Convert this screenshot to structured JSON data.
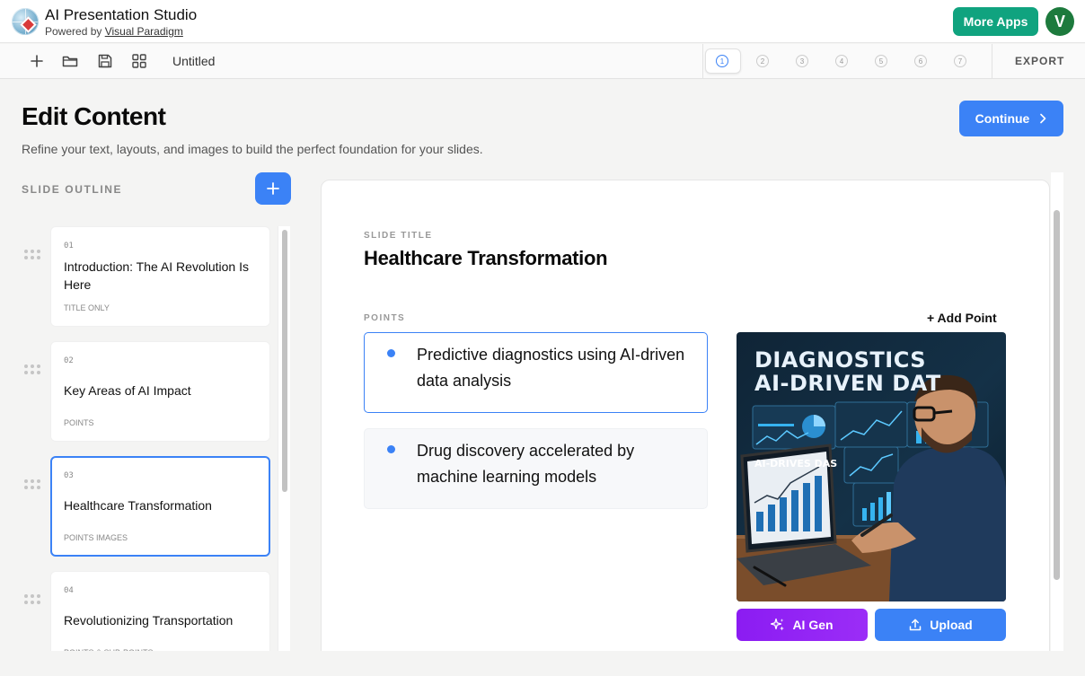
{
  "app": {
    "title": "AI Presentation Studio",
    "powered_prefix": "Powered by ",
    "powered_link": "Visual Paradigm",
    "more_apps": "More Apps",
    "avatar_letter": "V"
  },
  "toolbar": {
    "file_name": "Untitled",
    "steps": [
      "1",
      "2",
      "3",
      "4",
      "5",
      "6",
      "7"
    ],
    "active_step": "1",
    "export": "EXPORT",
    "icons": [
      "plus-icon",
      "folder-icon",
      "save-icon",
      "grid-icon"
    ]
  },
  "header": {
    "title": "Edit Content",
    "subtitle": "Refine your text, layouts, and images to build the perfect foundation for your slides.",
    "continue": "Continue"
  },
  "outline": {
    "label": "SLIDE OUTLINE",
    "slides": [
      {
        "num": "01",
        "title": "Introduction: The AI Revolution Is Here",
        "type": "TITLE ONLY"
      },
      {
        "num": "02",
        "title": "Key Areas of AI Impact",
        "type": "POINTS"
      },
      {
        "num": "03",
        "title": "Healthcare Transformation",
        "type": "POINTS IMAGES"
      },
      {
        "num": "04",
        "title": "Revolutionizing Transportation",
        "type": "POINTS & SUB-POINTS"
      }
    ],
    "active_index": 2
  },
  "editor": {
    "slide_title_label": "SLIDE TITLE",
    "slide_title": "Healthcare Transformation",
    "points_label": "POINTS",
    "add_point": "+ Add Point",
    "points": [
      "Predictive diagnostics using AI-driven data analysis",
      "Drug discovery accelerated by machine learning models"
    ],
    "image": {
      "headline_1": "DIAGNOSTICS",
      "headline_2": "AI-DRIVEN DAT",
      "laptop_text": "AI-DRIVES DAS"
    },
    "ai_gen": "AI Gen",
    "upload": "Upload"
  },
  "colors": {
    "primary": "#3b82f6",
    "more_apps": "#10a37f",
    "avatar": "#1d7a3d",
    "ai_gen": "#8b1cf2"
  }
}
